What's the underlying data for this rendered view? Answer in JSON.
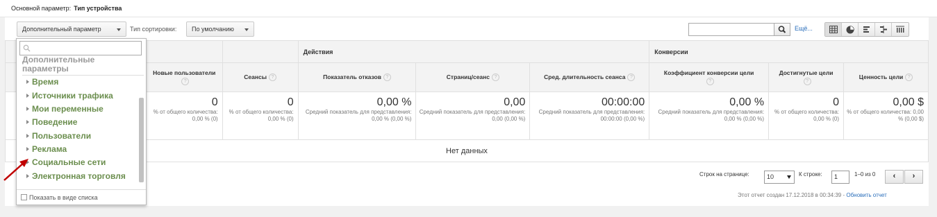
{
  "header": {
    "primary_label": "Основной параметр:",
    "primary_value": "Тип устройства"
  },
  "toolbar": {
    "secondary_dim_label": "Дополнительный параметр",
    "sort_label": "Тип сортировки:",
    "sort_value": "По умолчанию",
    "search_placeholder": "",
    "more_label": "Ещё...",
    "view_icons": [
      "table-view-icon",
      "pie-view-icon",
      "performance-view-icon",
      "comparison-view-icon",
      "pivot-view-icon"
    ]
  },
  "dropdown": {
    "search_placeholder": "",
    "heading": "Дополнительные параметры",
    "items": [
      {
        "label": "Время"
      },
      {
        "label": "Источники трафика"
      },
      {
        "label": "Мои переменные"
      },
      {
        "label": "Поведение"
      },
      {
        "label": "Пользователи"
      },
      {
        "label": "Реклама"
      },
      {
        "label": "Социальные сети"
      },
      {
        "label": "Электронная торговля"
      }
    ],
    "show_as_list_label": "Показать в виде списка"
  },
  "table": {
    "groups": [
      "Действия",
      "Конверсии"
    ],
    "columns": [
      {
        "label": "Новые пользователи",
        "total": "0",
        "sub": "% от общего количества: 0,00 % (0)"
      },
      {
        "label": "Сеансы",
        "total": "0",
        "sub": "% от общего количества: 0,00 % (0)"
      },
      {
        "label": "Показатель отказов",
        "total": "0,00 %",
        "sub": "Средний показатель для представления: 0,00 % (0,00 %)"
      },
      {
        "label": "Страниц/сеанс",
        "total": "0,00",
        "sub": "Средний показатель для представления: 0,00 (0,00 %)"
      },
      {
        "label": "Сред. длительность сеанса",
        "total": "00:00:00",
        "sub": "Средний показатель для представления: 00:00:00 (0,00 %)"
      },
      {
        "label": "Коэффициент конверсии цели",
        "total": "0,00 %",
        "sub": "Средний показатель для представления: 0,00 % (0,00 %)"
      },
      {
        "label": "Достигнутые цели",
        "total": "0",
        "sub": "% от общего количества: 0,00 % (0)"
      },
      {
        "label": "Ценность цели",
        "total": "0,00 $",
        "sub": "% от общего количества: 0,00 % (0,00 $)"
      }
    ],
    "no_data": "Нет данных"
  },
  "pagination": {
    "rows_per_page_label": "Строк на странице:",
    "rows_per_page_value": "10",
    "goto_label": "К строке:",
    "goto_value": "1",
    "range_text": "1–0 из 0",
    "prev": "‹",
    "next": "›"
  },
  "footer": {
    "created_text": "Этот отчет создан 17.12.2018 в 00:34:39 - ",
    "refresh_link": "Обновить отчет"
  },
  "colors": {
    "accent_link": "#2a6ebb",
    "dropdown_item": "#6b8e4e",
    "arrow": "#c00000"
  }
}
